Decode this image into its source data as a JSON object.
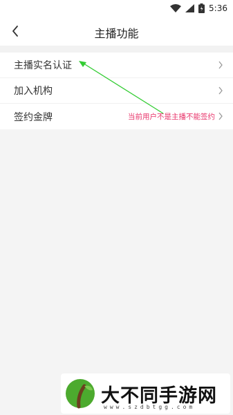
{
  "status_bar": {
    "time": "5:36"
  },
  "header": {
    "title": "主播功能"
  },
  "menu": {
    "items": [
      {
        "label": "主播实名认证",
        "note": ""
      },
      {
        "label": "加入机构",
        "note": ""
      },
      {
        "label": "签约金牌",
        "note": "当前用户不是主播不能签约"
      }
    ]
  },
  "watermark": {
    "title": "大不同手游网",
    "url": "www.szdbtgg.com"
  },
  "colors": {
    "note": "#e8356b",
    "arrow": "#33cc33",
    "watermark_leaf": "#4caa2e"
  },
  "icons": [
    "wifi-icon",
    "signal-icon",
    "battery-icon",
    "back-arrow-icon",
    "chevron-right-icon"
  ]
}
